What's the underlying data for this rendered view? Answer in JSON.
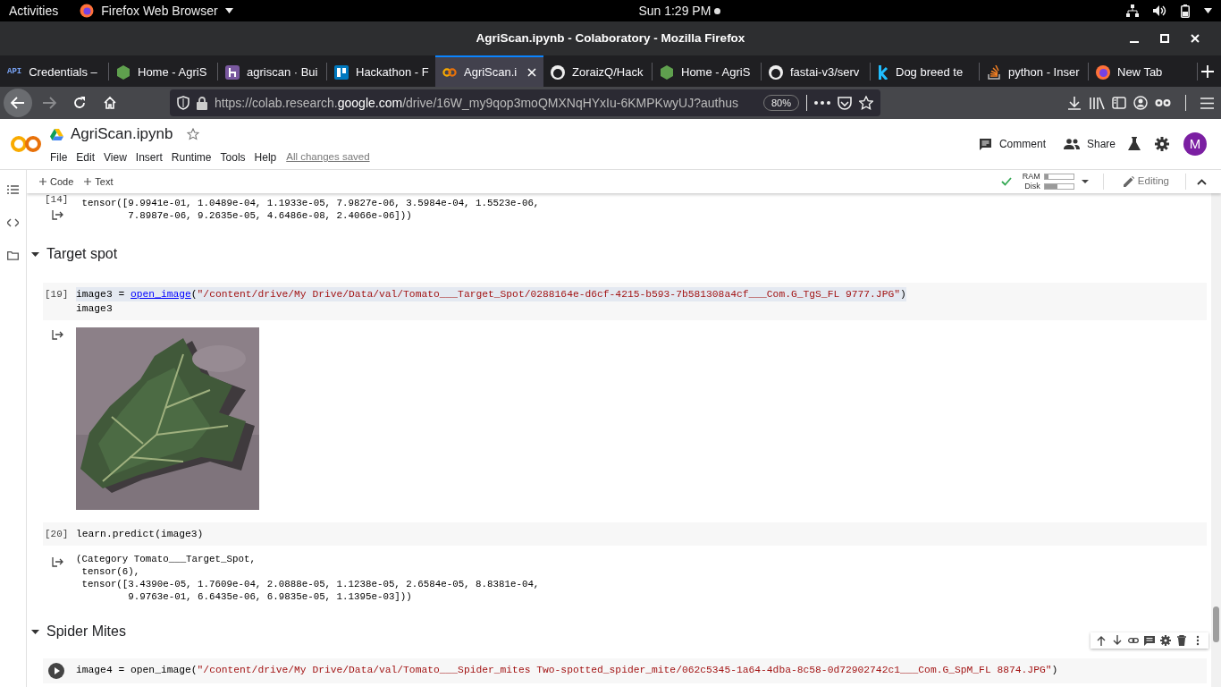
{
  "system_bar": {
    "activities": "Activities",
    "app": "Firefox Web Browser",
    "clock": "Sun 1:29 PM"
  },
  "window": {
    "title": "AgriScan.ipynb - Colaboratory - Mozilla Firefox"
  },
  "tabs": [
    {
      "icon_label": "API",
      "label": "Credentials –",
      "selected": false
    },
    {
      "label": "Home - AgriS",
      "selected": false
    },
    {
      "label": "agriscan · Bui",
      "selected": false
    },
    {
      "label": "Hackathon - F",
      "selected": false
    },
    {
      "label": "AgriScan.i",
      "selected": true
    },
    {
      "label": "ZoraizQ/Hack",
      "selected": false
    },
    {
      "label": "Home - AgriS",
      "selected": false
    },
    {
      "label": "fastai-v3/serv",
      "selected": false
    },
    {
      "label": "Dog breed te",
      "selected": false
    },
    {
      "label": "python - Inser",
      "selected": false
    },
    {
      "label": "New Tab",
      "selected": false
    }
  ],
  "navigation": {
    "back_enabled": true,
    "forward_enabled": false
  },
  "url": {
    "host": "https://colab.research.",
    "domain": "google.com",
    "path": "/drive/16W_my9qop3moQMXNqHYxIu-6KMPKwyUJ?authus",
    "zoom": "80%"
  },
  "notebook": {
    "title": "AgriScan.ipynb",
    "starred": false,
    "menu": [
      "File",
      "Edit",
      "View",
      "Insert",
      "Runtime",
      "Tools",
      "Help"
    ],
    "save_status": "All changes saved"
  },
  "actions": [
    "Comment",
    "Share"
  ],
  "avatar": "M",
  "toolbar": {
    "add_buttons": [
      "Code",
      "Text"
    ],
    "connected": true,
    "resources": [
      {
        "label": "RAM",
        "level": 0.12
      },
      {
        "label": "Disk",
        "level": 0.45
      }
    ],
    "mode": "Editing"
  },
  "cells": [
    {
      "kind": "output",
      "prompt": "[14]",
      "lines": [
        " tensor([9.9941e-01, 1.0489e-04, 1.1933e-05, 7.9827e-06, 3.5984e-04, 1.5523e-06,",
        "         7.8987e-06, 9.2635e-05, 4.6486e-08, 2.4066e-06]))"
      ]
    },
    {
      "kind": "heading",
      "text": "Target spot",
      "expanded": true
    },
    {
      "kind": "code",
      "prompt": "[19]",
      "lines": [
        {
          "highlighted": true,
          "tokens": [
            {
              "kind": "plain",
              "text": "image3 = "
            },
            {
              "kind": "link",
              "text": "open_image"
            },
            {
              "kind": "plain",
              "text": "("
            },
            {
              "kind": "string",
              "text": "\"/content/drive/My Drive/Data/val/Tomato___Target_Spot/0288164e-d6cf-4215-b593-7b581308a4cf___Com.G_TgS_FL 9777.JPG\""
            },
            {
              "kind": "plain",
              "text": ")"
            }
          ]
        },
        {
          "highlighted": false,
          "tokens": [
            {
              "kind": "plain",
              "text": "image3"
            }
          ]
        }
      ]
    },
    {
      "kind": "picture"
    },
    {
      "kind": "code",
      "prompt": "[20]",
      "lines": [
        {
          "highlighted": false,
          "tokens": [
            {
              "kind": "plain",
              "text": "learn.predict(image3)"
            }
          ]
        }
      ]
    },
    {
      "kind": "output",
      "lines": [
        "(Category Tomato___Target_Spot,",
        " tensor(6),",
        " tensor([3.4390e-05, 1.7609e-04, 2.0888e-05, 1.1238e-05, 2.6584e-05, 8.8381e-04,",
        "         9.9763e-01, 6.6435e-06, 6.9835e-05, 1.1395e-03]))"
      ]
    },
    {
      "kind": "heading",
      "text": "Spider Mites",
      "expanded": true
    },
    {
      "kind": "code",
      "run_button": true,
      "lines": [
        {
          "highlighted": false,
          "tokens": [
            {
              "kind": "plain",
              "text": "image4 = open_image("
            },
            {
              "kind": "string",
              "text": "\"/content/drive/My Drive/Data/val/Tomato___Spider_mites Two-spotted_spider_mite/062c5345-1a64-4dba-8c58-0d72902742c1___Com.G_SpM_FL 8874.JPG\""
            },
            {
              "kind": "plain",
              "text": ")"
            }
          ]
        }
      ]
    }
  ]
}
